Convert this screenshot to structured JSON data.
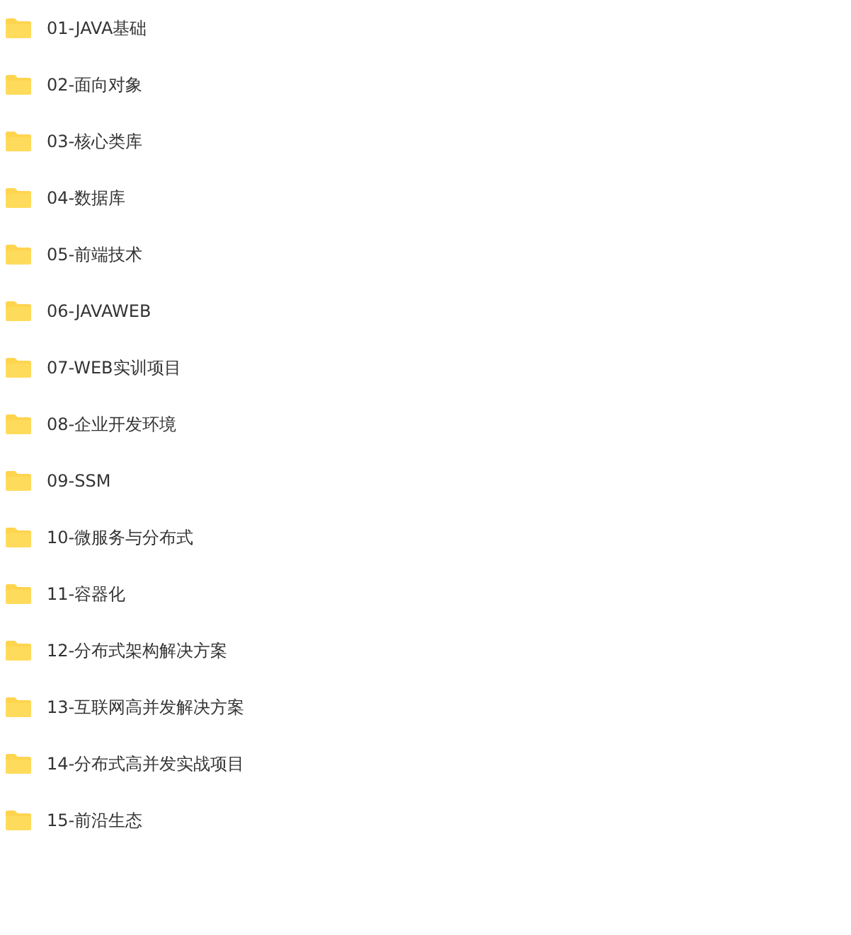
{
  "folders": [
    {
      "name": "01-JAVA基础"
    },
    {
      "name": "02-面向对象"
    },
    {
      "name": "03-核心类库"
    },
    {
      "name": "04-数据库"
    },
    {
      "name": "05-前端技术"
    },
    {
      "name": "06-JAVAWEB"
    },
    {
      "name": "07-WEB实训项目"
    },
    {
      "name": "08-企业开发环境"
    },
    {
      "name": "09-SSM"
    },
    {
      "name": "10-微服务与分布式"
    },
    {
      "name": "11-容器化"
    },
    {
      "name": "12-分布式架构解决方案"
    },
    {
      "name": "13-互联网高并发解决方案"
    },
    {
      "name": "14-分布式高并发实战项目"
    },
    {
      "name": "15-前沿生态"
    }
  ]
}
